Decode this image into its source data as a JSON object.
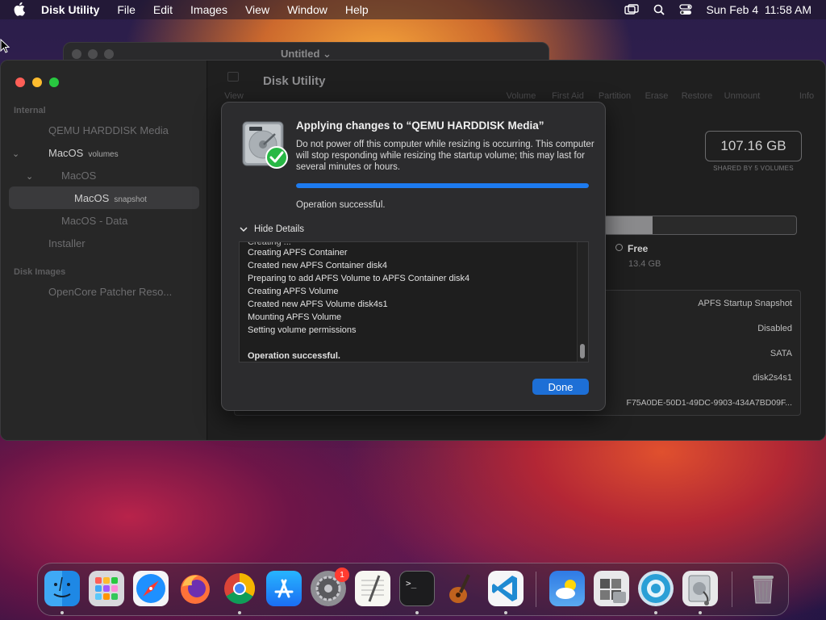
{
  "menubar": {
    "app_name": "Disk Utility",
    "items": [
      "File",
      "Edit",
      "Images",
      "View",
      "Window",
      "Help"
    ],
    "clock": "Sun Feb 4  11:58 AM"
  },
  "background_window": {
    "title": "Untitled"
  },
  "sidebar": {
    "section_internal": "Internal",
    "section_disk_images": "Disk Images",
    "items": [
      {
        "label": "QEMU HARDDISK Media",
        "sub": ""
      },
      {
        "label": "MacOS",
        "sub": "volumes"
      },
      {
        "label": "MacOS",
        "sub": ""
      },
      {
        "label": "MacOS",
        "sub": "snapshot"
      },
      {
        "label": "MacOS - Data",
        "sub": ""
      },
      {
        "label": "Installer",
        "sub": ""
      },
      {
        "label": "OpenCore Patcher Reso...",
        "sub": ""
      }
    ]
  },
  "toolbar": {
    "title": "Disk Utility",
    "buttons": [
      "View",
      "Volume",
      "First Aid",
      "Partition",
      "Erase",
      "Restore",
      "Unmount",
      "Info"
    ]
  },
  "detail": {
    "capacity": "107.16 GB",
    "capacity_caption": "SHARED BY 5 VOLUMES",
    "used_fraction": 0.25,
    "free_label": "Free",
    "free_size": "13.4 GB",
    "rows": [
      "APFS Startup Snapshot",
      "Disabled",
      "SATA",
      "disk2s4s1",
      "F75A0DE-50D1-49DC-9903-434A7BD09F..."
    ]
  },
  "dialog": {
    "title": "Applying changes to “QEMU HARDDISK Media”",
    "message": "Do not power off this computer while resizing is occurring. This computer will stop responding while resizing the startup volume; this may last for several minutes or hours.",
    "progress": 1.0,
    "status": "Operation successful.",
    "details_toggle": "Hide Details",
    "log": [
      "Creating APFS Container",
      "Created new APFS Container disk4",
      "Preparing to add APFS Volume to APFS Container disk4",
      "Creating APFS Volume",
      "Created new APFS Volume disk4s1",
      "Mounting APFS Volume",
      "Setting volume permissions",
      "",
      "Operation successful."
    ],
    "done_label": "Done"
  },
  "dock": {
    "apps": [
      "finder-icon",
      "launchpad-icon",
      "safari-icon",
      "firefox-icon",
      "chrome-icon",
      "app-store-icon",
      "system-settings-icon",
      "textedit-icon",
      "terminal-icon",
      "garageband-icon",
      "vscode-icon",
      "weather-icon",
      "boot-camp-icon",
      "opencore-icon",
      "disk-utility-icon",
      "trash-icon"
    ],
    "settings_badge": "1"
  },
  "colors": {
    "accent": "#1d7bf0",
    "done_button": "#1d6fd6"
  }
}
